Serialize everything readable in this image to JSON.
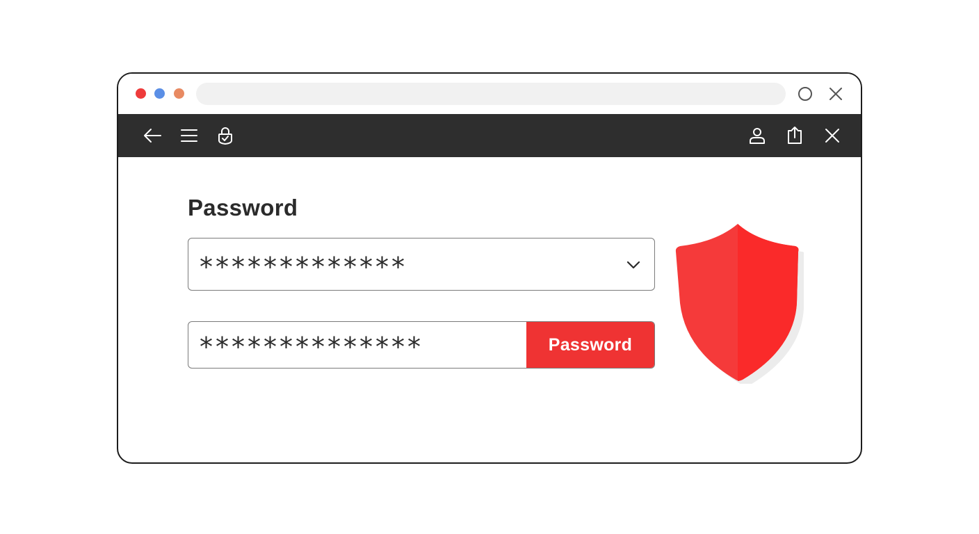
{
  "colors": {
    "dot_red": "#ee3b3b",
    "dot_blue": "#5b8fe6",
    "dot_orange": "#e88a62",
    "toolbar_bg": "#2e2e2e",
    "accent": "#ef3333"
  },
  "titlebar": {
    "icons": [
      "circle-icon",
      "close-icon"
    ]
  },
  "toolbar": {
    "left_icons": [
      "back-arrow-icon",
      "menu-icon",
      "lock-icon"
    ],
    "right_icons": [
      "user-icon",
      "share-icon",
      "close-icon"
    ]
  },
  "form": {
    "label": "Password",
    "field1_value": "*************",
    "field2_value": "**************",
    "button_label": "Password"
  },
  "decor": {
    "shield_icon": "shield-icon"
  }
}
